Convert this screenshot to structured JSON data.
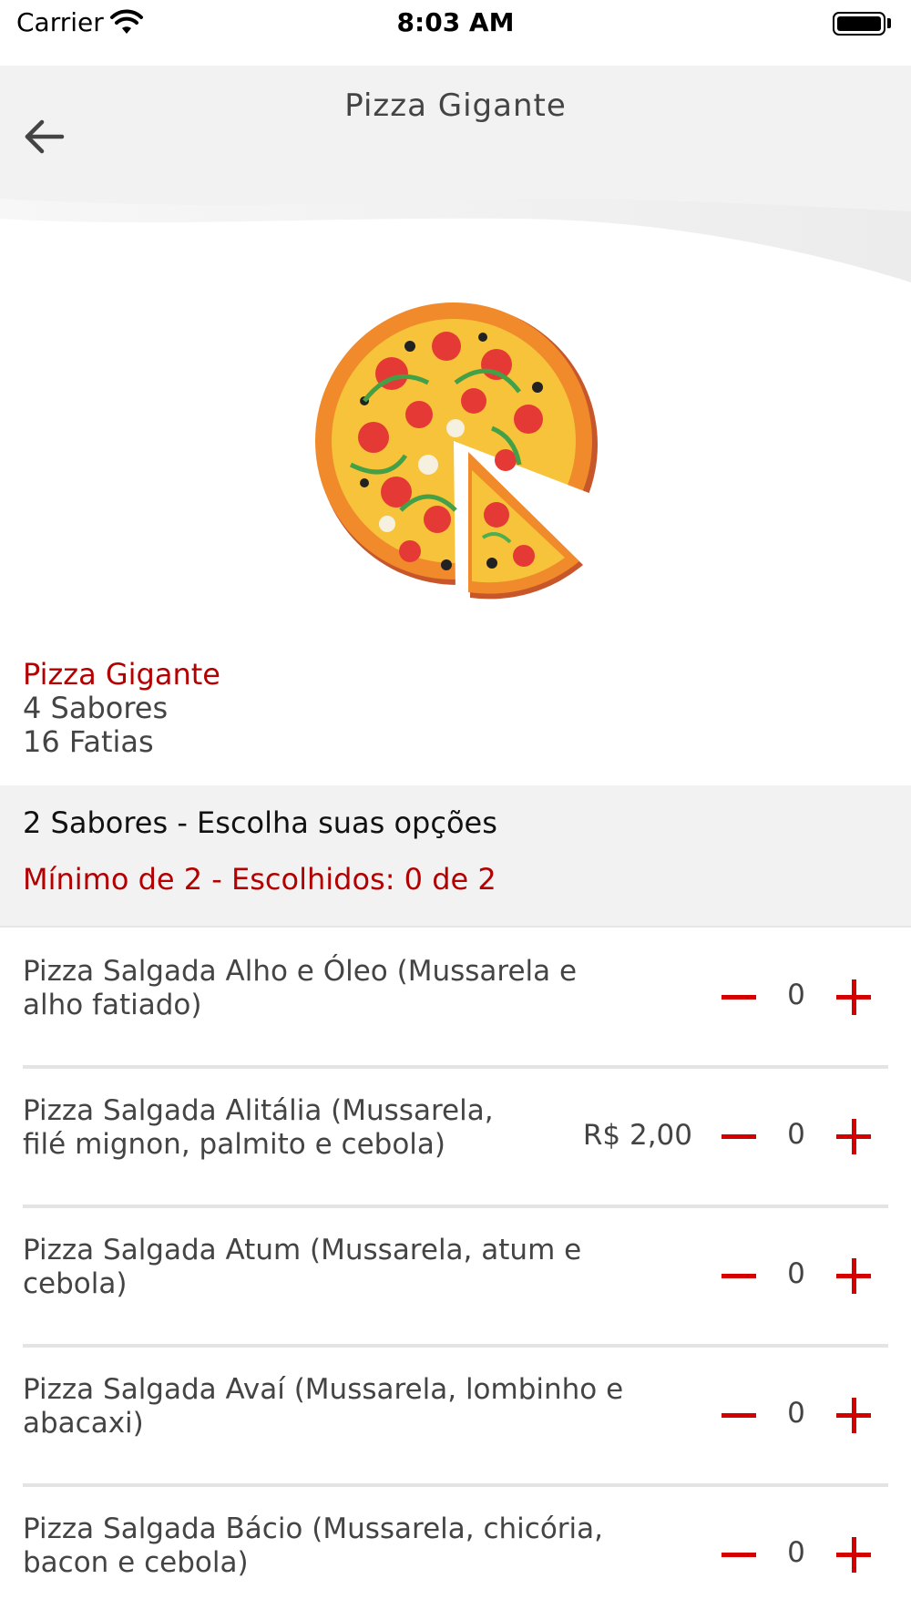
{
  "status_bar": {
    "carrier": "Carrier",
    "time": "8:03 AM"
  },
  "header": {
    "title": "Pizza Gigante",
    "back_icon": "arrow-left-icon"
  },
  "product": {
    "name": "Pizza Gigante",
    "flavors": "4 Sabores",
    "slices": "16 Fatias"
  },
  "section": {
    "title": "2 Sabores - Escolha suas opções",
    "rule": "Mínimo de 2 - Escolhidos: 0 de 2"
  },
  "options": [
    {
      "line1": "Pizza Salgada Alho e Óleo (Mussarela e",
      "line2": "alho fatiado)",
      "price": "",
      "qty": "0"
    },
    {
      "line1": "Pizza Salgada Alitália (Mussarela,",
      "line2": "filé mignon, palmito e cebola)",
      "price": "R$ 2,00",
      "qty": "0"
    },
    {
      "line1": "Pizza Salgada Atum (Mussarela, atum e",
      "line2": "cebola)",
      "price": "",
      "qty": "0"
    },
    {
      "line1": "Pizza Salgada Avaí (Mussarela, lombinho e",
      "line2": "abacaxi)",
      "price": "",
      "qty": "0"
    },
    {
      "line1": "Pizza Salgada Bácio (Mussarela, chicória,",
      "line2": "bacon e cebola)",
      "price": "",
      "qty": "0"
    }
  ],
  "colors": {
    "accent_red": "#b30000",
    "button_red": "#d40000",
    "section_bg": "#f2f2f2"
  }
}
